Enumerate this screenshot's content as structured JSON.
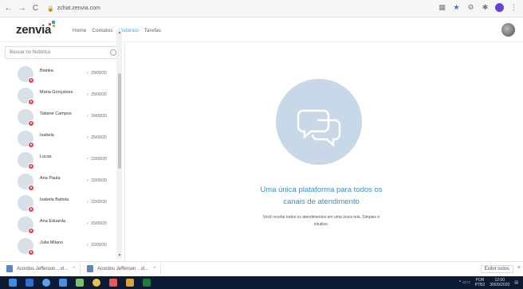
{
  "browser": {
    "url": "zchat.zenvia.com",
    "icons": [
      "extension-icon",
      "star-icon",
      "settings-icon",
      "puzzle-icon",
      "profile-icon",
      "menu-icon"
    ]
  },
  "app": {
    "logo": "zenvia",
    "nav": [
      {
        "label": "Home",
        "active": false
      },
      {
        "label": "Contatos",
        "active": false
      },
      {
        "label": "Histórico",
        "active": true
      },
      {
        "label": "Tarefas",
        "active": false
      }
    ],
    "accent": "#3a9bd5"
  },
  "sidebar": {
    "search_placeholder": "Buscar no histórico",
    "items": [
      {
        "name": "Bianka",
        "date": "29/09/20"
      },
      {
        "name": "Maria Gonçalves",
        "date": "25/09/20"
      },
      {
        "name": "Tatiane Campos",
        "date": "24/09/20"
      },
      {
        "name": "Isabela",
        "date": "25/09/20"
      },
      {
        "name": "Lucas",
        "date": "22/09/20"
      },
      {
        "name": "Ana Paula",
        "date": "22/09/20"
      },
      {
        "name": "Isabela Batista",
        "date": "22/09/20"
      },
      {
        "name": "Ana Eduarda",
        "date": "15/09/20"
      },
      {
        "name": "Julia Milano",
        "date": "15/09/20"
      }
    ]
  },
  "main": {
    "headline_line1": "Uma única plataforma para todos os",
    "headline_line2": "canais de atendimento",
    "body_line1": "Você recebe todos os atendimentos em uma única tela. Simples e",
    "body_line2": "intuitivo."
  },
  "downloads": {
    "items": [
      {
        "label": "Acordos Jefferson ...xl..."
      },
      {
        "label": "Acordos Jefferson ...xl..."
      }
    ],
    "show_all": "Exibir todos"
  },
  "taskbar": {
    "lang_line1": "POR",
    "lang_line2": "PTB2",
    "time": "12:00",
    "date": "30/09/2020"
  }
}
